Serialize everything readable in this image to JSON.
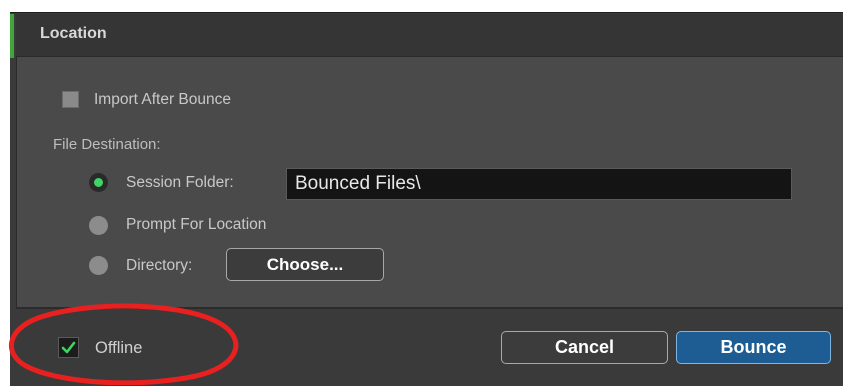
{
  "panel": {
    "title": "Location"
  },
  "options": {
    "import_after_bounce_label": "Import After Bounce",
    "import_after_bounce_checked": false,
    "file_destination_label": "File Destination:",
    "destinations": [
      {
        "label": "Session Folder:",
        "selected": true
      },
      {
        "label": "Prompt For Location",
        "selected": false
      },
      {
        "label": "Directory:",
        "selected": false
      }
    ],
    "session_folder_value": "Bounced Files\\",
    "choose_button_label": "Choose..."
  },
  "footer": {
    "offline_label": "Offline",
    "offline_checked": true,
    "cancel_label": "Cancel",
    "bounce_label": "Bounce"
  },
  "colors": {
    "selected_radio": "#3fd463",
    "offline_check": "#3fd463",
    "bounce_button": "#1d5d93",
    "annotation_ellipse": "#e8201f"
  },
  "icons": {
    "offline_check": "checkmark-icon"
  }
}
